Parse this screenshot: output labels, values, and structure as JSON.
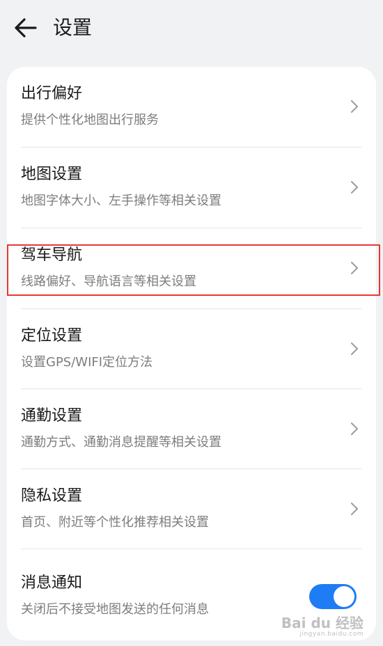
{
  "header": {
    "title": "设置",
    "back_icon": "arrow-left-icon"
  },
  "settings": [
    {
      "title": "出行偏好",
      "subtitle": "提供个性化地图出行服务",
      "control": "chevron"
    },
    {
      "title": "地图设置",
      "subtitle": "地图字体大小、左手操作等相关设置",
      "control": "chevron"
    },
    {
      "title": "驾车导航",
      "subtitle": "线路偏好、导航语言等相关设置",
      "control": "chevron",
      "highlighted": true
    },
    {
      "title": "定位设置",
      "subtitle": "设置GPS/WIFI定位方法",
      "control": "chevron"
    },
    {
      "title": "通勤设置",
      "subtitle": "通勤方式、通勤消息提醒等相关设置",
      "control": "chevron"
    },
    {
      "title": "隐私设置",
      "subtitle": "首页、附近等个性化推荐相关设置",
      "control": "chevron"
    },
    {
      "title": "消息通知",
      "subtitle": "关闭后不接受地图发送的任何消息",
      "control": "toggle",
      "toggle_on": true
    }
  ],
  "watermark": {
    "brand": "Bai du 经验",
    "url": "jingyan.baidu.com"
  },
  "colors": {
    "background": "#f1f2f4",
    "card": "#ffffff",
    "accent": "#1e7cf4",
    "highlight": "#e53935"
  }
}
